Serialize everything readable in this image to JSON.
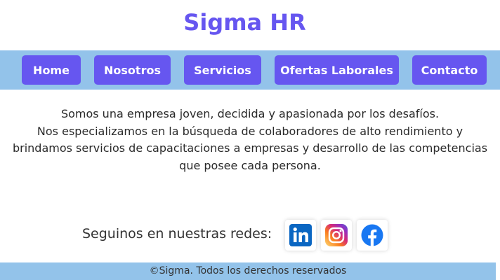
{
  "header": {
    "title": "Sigma HR"
  },
  "nav": {
    "items": [
      {
        "label": "Home"
      },
      {
        "label": "Nosotros"
      },
      {
        "label": "Servicios"
      },
      {
        "label": "Ofertas Laborales"
      },
      {
        "label": "Contacto"
      }
    ]
  },
  "about": {
    "line1": "Somos una empresa joven, decidida y apasionada por los desafíos.",
    "line2": "Nos especializamos en la búsqueda de colaboradores de alto rendimiento y brindamos servicios de capacitaciones a empresas y desarrollo de las competencias que posee cada persona."
  },
  "social": {
    "label": "Seguinos en nuestras redes:",
    "icons": [
      "linkedin-icon",
      "instagram-icon",
      "facebook-icon"
    ]
  },
  "footer": {
    "text": "©Sigma. Todos los derechos reservados"
  },
  "colors": {
    "accent": "#6656f0",
    "band": "#93c3ea"
  }
}
